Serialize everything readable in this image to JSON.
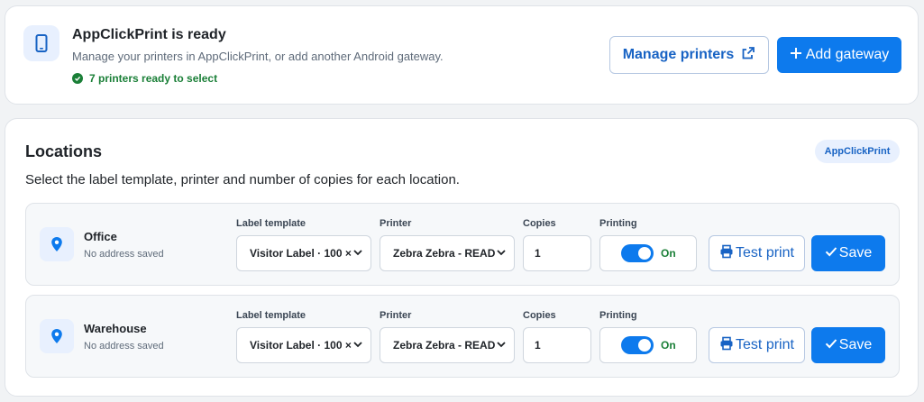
{
  "header": {
    "title": "AppClickPrint is ready",
    "subtitle": "Manage your printers in AppClickPrint, or add another Android gateway.",
    "status": "7 printers ready to select",
    "manage_label": "Manage printers",
    "add_label": "Add gateway",
    "icons": {
      "app": "phone-icon",
      "status": "check-circle-icon",
      "manage": "external-link-icon",
      "add": "plus-icon"
    }
  },
  "locations": {
    "title": "Locations",
    "description": "Select the label template, printer and number of copies for each location.",
    "badge": "AppClickPrint",
    "field_labels": {
      "template": "Label template",
      "printer": "Printer",
      "copies": "Copies",
      "printing": "Printing"
    },
    "rows": [
      {
        "name": "Office",
        "address": "No address saved",
        "template": "Visitor Label · 100 ×",
        "printer": "Zebra Zebra - READ",
        "copies": "1",
        "printing": "On",
        "printing_enabled": true,
        "test_label": "Test print",
        "save_label": "Save"
      },
      {
        "name": "Warehouse",
        "address": "No address saved",
        "template": "Visitor Label · 100 ×",
        "printer": "Zebra Zebra - READ",
        "copies": "1",
        "printing": "On",
        "printing_enabled": true,
        "test_label": "Test print",
        "save_label": "Save"
      }
    ]
  },
  "colors": {
    "primary": "#0d7aed",
    "link": "#1863c4",
    "success": "#1a7f37",
    "soft_blue": "#e8f0fe"
  }
}
